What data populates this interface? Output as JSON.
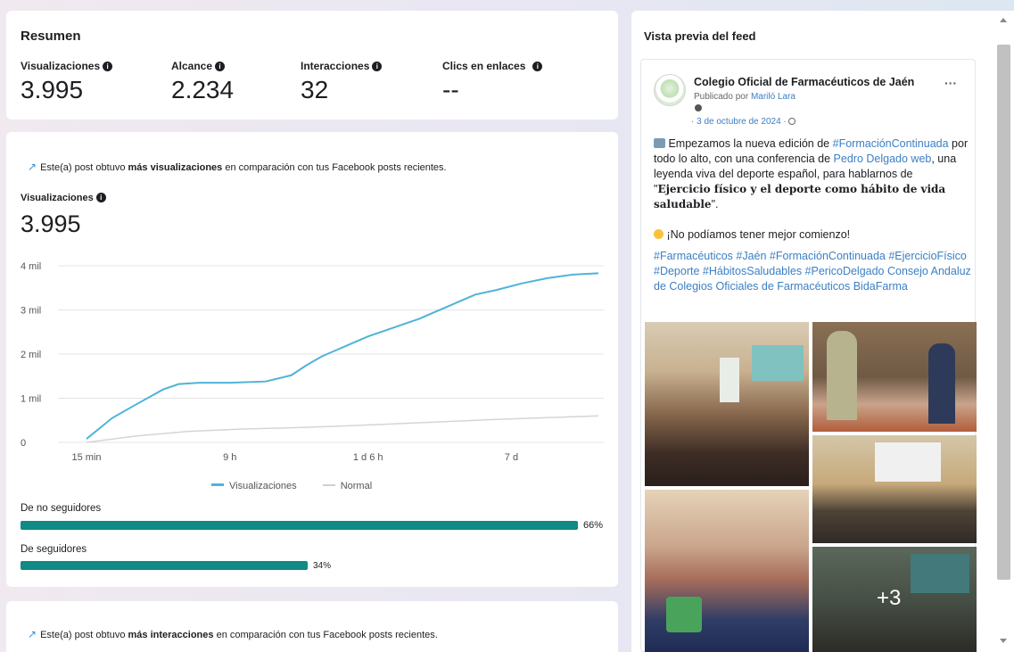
{
  "summary": {
    "title": "Resumen",
    "metrics": [
      {
        "label": "Visualizaciones",
        "value": "3.995",
        "info": true
      },
      {
        "label": "Alcance",
        "value": "2.234",
        "info": true
      },
      {
        "label": "Interacciones",
        "value": "32",
        "info": true
      },
      {
        "label": "Clics en enlaces",
        "value": "--",
        "info": true
      }
    ]
  },
  "views_card": {
    "trend_pre": "Este(a) post obtuvo ",
    "trend_bold": "más visualizaciones",
    "trend_post": " en comparación con tus Facebook posts recientes.",
    "metric_label": "Visualizaciones",
    "metric_value": "3.995",
    "bars": [
      {
        "label": "De no seguidores",
        "percent_text": "66%",
        "fraction": 0.66
      },
      {
        "label": "De seguidores",
        "percent_text": "34%",
        "fraction": 0.34
      }
    ]
  },
  "chart_data": {
    "type": "line",
    "x_ticks": [
      "15 min",
      "9 h",
      "1 d 6 h",
      "7 d"
    ],
    "y_ticks": [
      "0",
      "1 mil",
      "2 mil",
      "3 mil",
      "4 mil"
    ],
    "ylim": [
      0,
      4000
    ],
    "legend_position": "bottom-center",
    "grid": true,
    "series": [
      {
        "name": "Visualizaciones",
        "color": "#4fb3d9",
        "x": [
          0,
          0.05,
          0.1,
          0.15,
          0.18,
          0.22,
          0.28,
          0.35,
          0.4,
          0.43,
          0.46,
          0.5,
          0.55,
          0.6,
          0.62,
          0.65,
          0.68,
          0.7,
          0.73,
          0.76,
          0.8,
          0.85,
          0.9,
          0.95,
          1.0
        ],
        "values": [
          80,
          550,
          880,
          1200,
          1320,
          1350,
          1350,
          1380,
          1520,
          1750,
          1950,
          2150,
          2400,
          2600,
          2680,
          2800,
          2950,
          3050,
          3200,
          3350,
          3450,
          3600,
          3720,
          3800,
          3830
        ]
      },
      {
        "name": "Normal",
        "color": "#d5d5d5",
        "x": [
          0,
          0.1,
          0.2,
          0.3,
          0.4,
          0.5,
          0.6,
          0.7,
          0.8,
          0.9,
          1.0
        ],
        "values": [
          0,
          150,
          250,
          300,
          330,
          370,
          420,
          470,
          520,
          560,
          600
        ]
      }
    ]
  },
  "interactions_card": {
    "trend_pre": "Este(a) post obtuvo ",
    "trend_bold": "más interacciones",
    "trend_post": " en comparación con tus Facebook posts recientes."
  },
  "feed": {
    "title": "Vista previa del feed",
    "page_name": "Colegio Oficial de Farmacéuticos de Jaén",
    "published_by_prefix": "Publicado por ",
    "published_by_name": "Mariló Lara",
    "date": "· 3 de octubre de 2024 ·",
    "more": "···",
    "p1_pre": " Empezamos la nueva edición de ",
    "p1_tag": "#FormaciónContinuada",
    "p1_mid": " por todo lo alto, con una conferencia de ",
    "p1_link": "Pedro Delgado web",
    "p1_mid2": ", una leyenda viva del deporte español, para hablarnos de \"",
    "p1_serif": "Ejercicio físico y el deporte como hábito de vida saludable",
    "p1_end": "\".",
    "p2": " ¡No podíamos tener mejor comienzo!",
    "hashtags": "#Farmacéuticos #Jaén #FormaciónContinuada #EjercicioFísico #Deporte #HábitosSaludables #PericoDelgado Consejo Andaluz de Colegios Oficiales de Farmacéuticos BidaFarma",
    "more_photos": "+3"
  }
}
